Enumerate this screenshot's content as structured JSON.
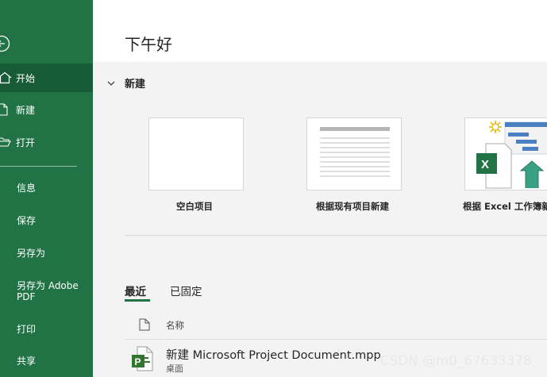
{
  "nav": {
    "items": [
      {
        "label": "开始",
        "icon": "home-icon"
      },
      {
        "label": "新建",
        "icon": "new-file-icon"
      },
      {
        "label": "打开",
        "icon": "open-folder-icon"
      }
    ],
    "plain": [
      {
        "label": "信息"
      },
      {
        "label": "保存"
      },
      {
        "label": "另存为"
      },
      {
        "label": "另存为 Adobe PDF"
      },
      {
        "label": "打印"
      },
      {
        "label": "共享"
      }
    ]
  },
  "greeting": "下午好",
  "new_section": {
    "title": "新建",
    "templates": [
      {
        "label": "空白项目"
      },
      {
        "label": "根据现有项目新建"
      },
      {
        "label": "根据 Excel 工作簿新建"
      }
    ]
  },
  "tabs": [
    {
      "label": "最近"
    },
    {
      "label": "已固定"
    }
  ],
  "list": {
    "column_name": "名称",
    "files": [
      {
        "name": "新建 Microsoft Project Document.mpp",
        "location": "桌面"
      }
    ]
  },
  "watermark": "CSDN @m0_67633378",
  "colors": {
    "accent": "#217346",
    "accent_dark": "#185c37",
    "project": "#31752f"
  }
}
